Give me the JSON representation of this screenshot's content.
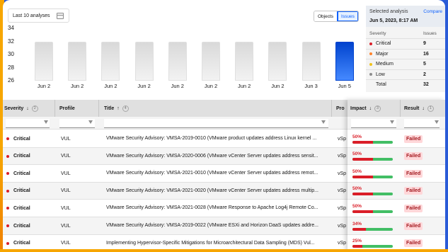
{
  "toolbar": {
    "range_label": "Last 10 analyses",
    "view_toggle": [
      {
        "label": "Objects",
        "active": false
      },
      {
        "label": "Issues",
        "active": true
      }
    ]
  },
  "chart_data": {
    "type": "bar",
    "categories": [
      "Jun 2",
      "Jun 2",
      "Jun 2",
      "Jun 2",
      "Jun 2",
      "Jun 2",
      "Jun 2",
      "Jun 2",
      "Jun 3",
      "Jun 5"
    ],
    "values": [
      32,
      32,
      32,
      32,
      32,
      32,
      32,
      32,
      32,
      32
    ],
    "selected_index": 9,
    "yticks": [
      "34",
      "32",
      "30",
      "28",
      "26"
    ],
    "ylim": [
      26,
      34
    ],
    "selected_color": "#0043ce",
    "default_color": "#e0e0e0"
  },
  "summary": {
    "title": "Selected analysis",
    "compare_label": "Compare",
    "date": "Jun 5, 2023, 8:17 AM",
    "col_severity": "Severity",
    "col_issues": "Issues",
    "rows": [
      {
        "label": "Critical",
        "value": "9",
        "color": "#da1e28"
      },
      {
        "label": "Major",
        "value": "16",
        "color": "#ff832b"
      },
      {
        "label": "Medium",
        "value": "5",
        "color": "#f1c21b"
      },
      {
        "label": "Low",
        "value": "2",
        "color": "#8d8d8d"
      }
    ],
    "total_label": "Total",
    "total_value": "32"
  },
  "table": {
    "headers": {
      "severity": "Severity",
      "severity_sort": "2",
      "profile": "Profile",
      "title": "Title",
      "title_sort": "4",
      "pro": "Pro",
      "impact": "Impact",
      "impact_sort": "3",
      "result": "Result",
      "result_sort": "1"
    },
    "rows": [
      {
        "severity": "Critical",
        "profile": "VUL",
        "title": "VMware Security Advisory: VMSA-2019-0010 (VMware product updates address Linux kernel ...",
        "pro": "vSp",
        "impact": "50%",
        "impact_value": 50,
        "result": "Failed"
      },
      {
        "severity": "Critical",
        "profile": "VUL",
        "title": "VMware Security Advisory: VMSA-2020-0006 (VMware vCenter Server updates address sensit...",
        "pro": "vSp",
        "impact": "50%",
        "impact_value": 50,
        "result": "Failed"
      },
      {
        "severity": "Critical",
        "profile": "VUL",
        "title": "VMware Security Advisory: VMSA-2021-0010 (VMware vCenter Server updates address remot...",
        "pro": "vSp",
        "impact": "50%",
        "impact_value": 50,
        "result": "Failed"
      },
      {
        "severity": "Critical",
        "profile": "VUL",
        "title": "VMware Security Advisory: VMSA-2021-0020 (VMware vCenter Server updates address multip...",
        "pro": "vSp",
        "impact": "50%",
        "impact_value": 50,
        "result": "Failed"
      },
      {
        "severity": "Critical",
        "profile": "VUL",
        "title": "VMware Security Advisory: VMSA-2021-0028 (VMware Response to Apache Log4j Remote Co...",
        "pro": "vSp",
        "impact": "50%",
        "impact_value": 50,
        "result": "Failed"
      },
      {
        "severity": "Critical",
        "profile": "VUL",
        "title": "VMware Security Advisory: VMSA-2019-0022 (VMware ESXi and Horizon DaaS updates addre...",
        "pro": "vSp",
        "impact": "34%",
        "impact_value": 34,
        "result": "Failed"
      },
      {
        "severity": "Critical",
        "profile": "VUL",
        "title": "Implementing Hypervisor-Specific Mitigations for Microarchitectural Data Sampling (MDS) Vul...",
        "pro": "vSp",
        "impact": "25%",
        "impact_value": 25,
        "result": "Failed"
      }
    ]
  }
}
